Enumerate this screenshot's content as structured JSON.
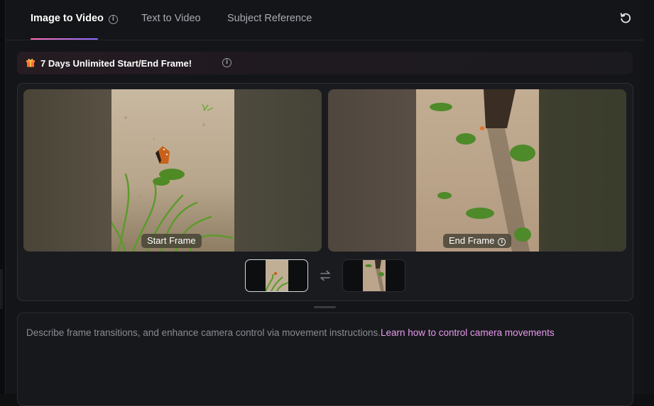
{
  "tabs": [
    {
      "label": "Image to Video",
      "active": true
    },
    {
      "label": "Text to Video",
      "active": false
    },
    {
      "label": "Subject Reference",
      "active": false
    }
  ],
  "promo": {
    "text": "7 Days Unlimited Start/End Frame!",
    "icon": "gift-icon"
  },
  "frames": {
    "start": {
      "label": "Start Frame"
    },
    "end": {
      "label": "End Frame"
    }
  },
  "prompt": {
    "placeholder": "Describe frame transitions, and enhance camera control via movement instructions.",
    "link": "Learn how to control camera movements"
  },
  "colors": {
    "accent_start": "#ff6fb5",
    "accent_end": "#8a6cff",
    "link": "#e79bf0"
  },
  "icons": [
    "info-icon",
    "refresh-icon",
    "gift-icon",
    "swap-icon"
  ]
}
